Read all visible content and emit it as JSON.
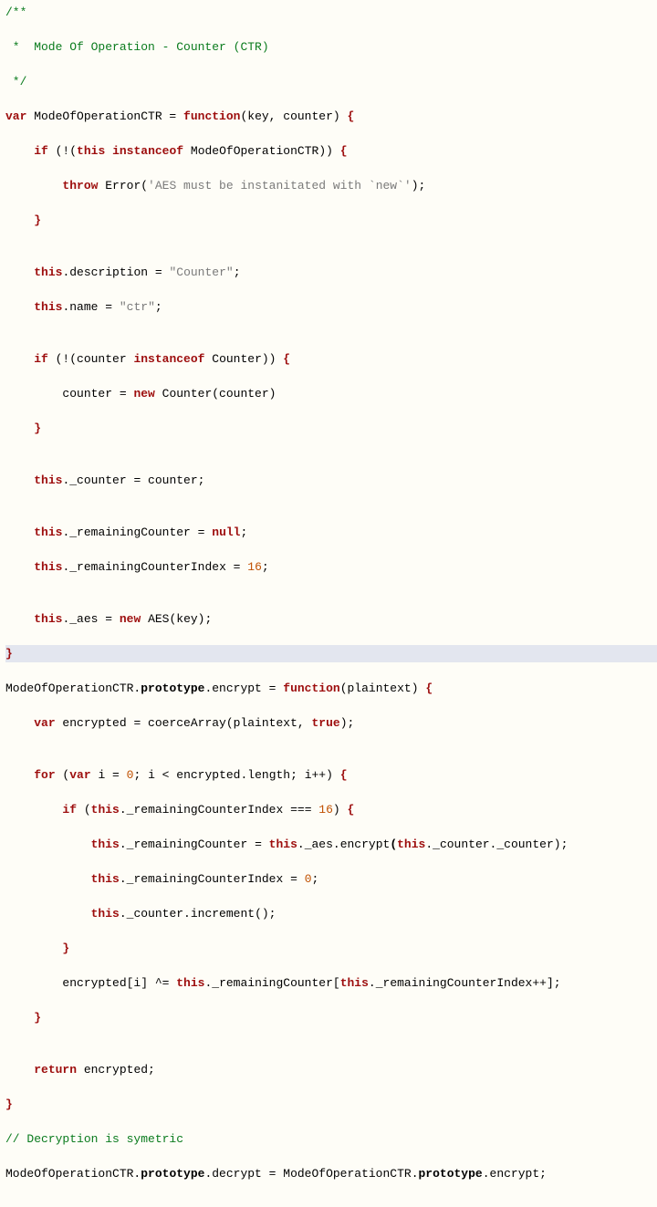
{
  "code": {
    "l01": "/**",
    "l02_a": " *  Mode Of Operation - Counter (CTR)",
    "l03": " */",
    "l04_var": "var",
    "l04_name": " ModeOfOperationCTR = ",
    "l04_func": "function",
    "l04_params": "(key, counter) ",
    "l04_brace": "{",
    "l05_if": "if",
    "l05_a": " (!(",
    "l05_this": "this",
    "l05_b": " ",
    "l05_inst": "instanceof",
    "l05_c": " ModeOfOperationCTR)) ",
    "l05_brace": "{",
    "l06_throw": "throw",
    "l06_a": " Error(",
    "l06_str": "'AES must be instanitated with `new`'",
    "l06_b": ");",
    "l07_brace": "}",
    "l08_this": "this",
    "l08_a": ".description = ",
    "l08_str": "\"Counter\"",
    "l08_b": ";",
    "l09_this": "this",
    "l09_a": ".name = ",
    "l09_str": "\"ctr\"",
    "l09_b": ";",
    "l10_if": "if",
    "l10_a": " (!(counter ",
    "l10_inst": "instanceof",
    "l10_b": " Counter)) ",
    "l10_brace": "{",
    "l11_a": "counter = ",
    "l11_new": "new",
    "l11_b": " Counter(counter)",
    "l12_brace": "}",
    "l13_this": "this",
    "l13_a": "._counter = counter;",
    "l14_this": "this",
    "l14_a": "._remainingCounter = ",
    "l14_null": "null",
    "l14_b": ";",
    "l15_this": "this",
    "l15_a": "._remainingCounterIndex = ",
    "l15_num": "16",
    "l15_b": ";",
    "l16_this": "this",
    "l16_a": "._aes = ",
    "l16_new": "new",
    "l16_b": " AES(key);",
    "l17_brace": "}",
    "l18_a": "ModeOfOperationCTR.",
    "l18_proto": "prototype",
    "l18_b": ".encrypt = ",
    "l18_func": "function",
    "l18_c": "(plaintext) ",
    "l18_brace": "{",
    "l19_var": "var",
    "l19_a": " encrypted = coerceArray(plaintext, ",
    "l19_true": "true",
    "l19_b": ");",
    "l20_for": "for",
    "l20_a": " (",
    "l20_var": "var",
    "l20_b": " i = ",
    "l20_n0": "0",
    "l20_c": "; i < encrypted.length; i++) ",
    "l20_brace": "{",
    "l21_if": "if",
    "l21_a": " (",
    "l21_this": "this",
    "l21_b": "._remainingCounterIndex === ",
    "l21_num": "16",
    "l21_c": ") ",
    "l21_brace": "{",
    "l22_this1": "this",
    "l22_a": "._remainingCounter = ",
    "l22_this2": "this",
    "l22_b": "._aes.encrypt",
    "l22_c": "(",
    "l22_this3": "this",
    "l22_d": "._counter._counter);",
    "l23_this": "this",
    "l23_a": "._remainingCounterIndex = ",
    "l23_num": "0",
    "l23_b": ";",
    "l24_this": "this",
    "l24_a": "._counter.increment();",
    "l25_brace": "}",
    "l26_a": "encrypted[i] ^= ",
    "l26_this1": "this",
    "l26_b": "._remainingCounter[",
    "l26_this2": "this",
    "l26_c": "._remainingCounterIndex++];",
    "l27_brace": "}",
    "l28_ret": "return",
    "l28_a": " encrypted;",
    "l29_brace": "}",
    "l30_comment": "// Decryption is symetric",
    "l31_a": "ModeOfOperationCTR.",
    "l31_proto1": "prototype",
    "l31_b": ".decrypt = ModeOfOperationCTR.",
    "l31_proto2": "prototype",
    "l31_c": ".encrypt;"
  }
}
